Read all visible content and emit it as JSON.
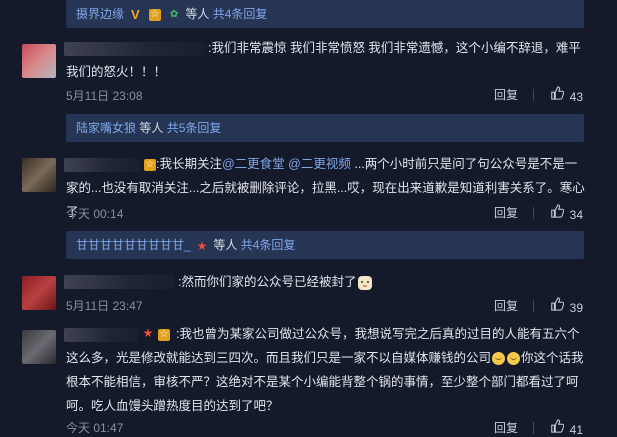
{
  "replies": [
    {
      "names": "摄界边缘",
      "suffix": "等人",
      "more": "共4条回复"
    },
    {
      "names": "陆家嘴女狼",
      "suffix": "等人",
      "more": "共5条回复"
    },
    {
      "names": "甘甘甘甘甘甘甘甘甘_",
      "suffix": "等人",
      "more": "共4条回复"
    }
  ],
  "comments": [
    {
      "text": ":我们非常震惊 我们非常愤怒 我们非常遗憾，这个小编不辞退，难平我们的怒火！！！",
      "time": "5月11日 23:08",
      "reply_label": "回复",
      "likes": "43"
    },
    {
      "text_prefix": ":我长期关注",
      "mention1": "@二更食堂",
      "mention2": "@二更视频",
      "text_rest": " ...两个小时前只是问了句公众号是不是一家的...也没有取消关注...之后就被删除评论，拉黑...哎，现在出来道歉是知道利害关系了。寒心了",
      "time": "今天 00:14",
      "reply_label": "回复",
      "likes": "34"
    },
    {
      "text": ":然而你们家的公众号已经被封了",
      "time": "5月11日 23:47",
      "reply_label": "回复",
      "likes": "39"
    },
    {
      "text_prefix": ":我也曾为某家公司做过公众号，我想说写完之后真的过目的人能有五六个这么多，光是修改就能达到三四次。而且我们只是一家不以自媒体赚钱的公司",
      "text_rest": "你这个话我根本不能相信，审核不严？这绝对不是某个小编能背整个锅的事情，至少整个部门都看过了呵呵。吃人血馒头蹭热度目的达到了吧？",
      "time": "今天 01:47",
      "reply_label": "回复",
      "likes": "41"
    }
  ]
}
